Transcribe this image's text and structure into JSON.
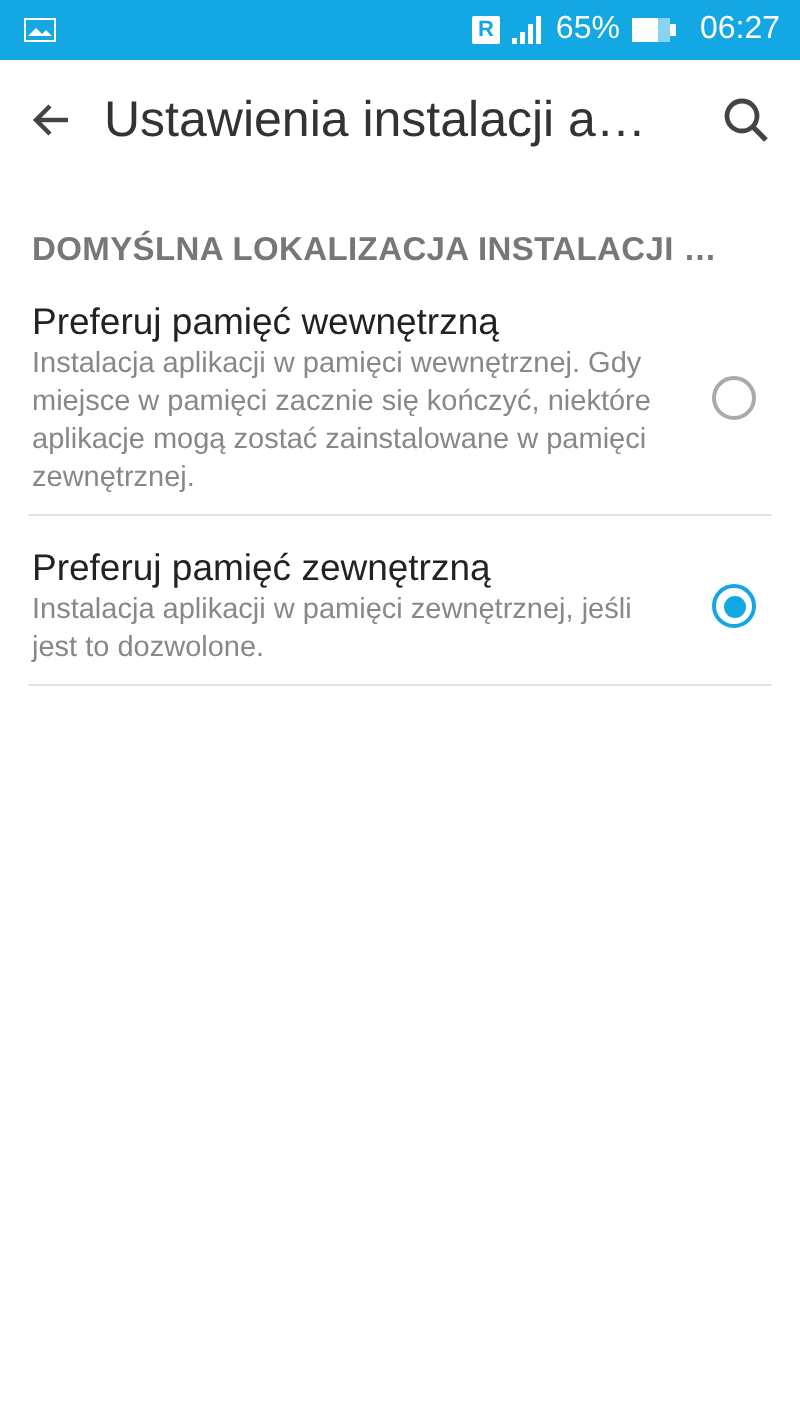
{
  "status_bar": {
    "roaming_badge": "R",
    "battery": "65%",
    "time": "06:27"
  },
  "toolbar": {
    "title": "Ustawienia instalacji a…"
  },
  "section": {
    "header": "DOMYŚLNA LOKALIZACJA INSTALACJI …",
    "options": [
      {
        "title": "Preferuj pamięć wewnętrzną",
        "description": "Instalacja aplikacji w pamięci wewnętrznej. Gdy miejsce w pamięci zacznie się kończyć, niektóre aplikacje mogą zostać zainstalowane w pamięci zewnętrznej.",
        "selected": false
      },
      {
        "title": "Preferuj pamięć zewnętrzną",
        "description": "Instalacja aplikacji w pamięci zewnętrznej, jeśli jest to dozwolone.",
        "selected": true
      }
    ]
  }
}
